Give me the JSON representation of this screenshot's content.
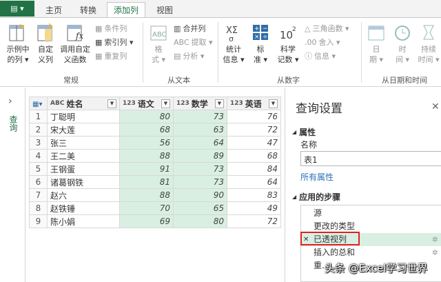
{
  "ribbon": {
    "file_label": "▤ ▾",
    "tabs": [
      "主页",
      "转换",
      "添加列",
      "视图"
    ],
    "groups": {
      "general": {
        "label": "常规",
        "example_col": [
          "示例中",
          "的列 ▾"
        ],
        "custom_col": [
          "自定",
          "义列"
        ],
        "invoke_fn": [
          "调用自定",
          "义函数"
        ],
        "conditional_col": "条件列",
        "index_col": "索引列 ▾",
        "duplicate_col": "重复列"
      },
      "from_text": {
        "label": "从文本",
        "format": [
          "格",
          "式 ▾"
        ],
        "merge_col": "合并列",
        "extract": "提取 ▾",
        "parse": "分析 ▾"
      },
      "from_number": {
        "label": "从数字",
        "statistics": [
          "统计",
          "信息 ▾"
        ],
        "standard": [
          "标",
          "准 ▾"
        ],
        "scientific": [
          "科学",
          "记数 ▾"
        ],
        "trig": "三角函数 ▾",
        "rounding": "舍入 ▾",
        "information": "信息 ▾"
      },
      "from_datetime": {
        "label": "从日期和时间",
        "date": [
          "日",
          "期 ▾"
        ],
        "time": [
          "时",
          "间 ▾"
        ],
        "duration": [
          "持续",
          "时间 ▾"
        ]
      }
    }
  },
  "left_pane": {
    "label": "查询",
    "chevron": "›"
  },
  "grid": {
    "columns": [
      {
        "type": "ABC",
        "name": "姓名"
      },
      {
        "type": "123",
        "name": "语文"
      },
      {
        "type": "123",
        "name": "数学"
      },
      {
        "type": "123",
        "name": "英语"
      }
    ],
    "rows": [
      {
        "i": "1",
        "name": "丁聪明",
        "a": "80",
        "b": "73",
        "c": "76"
      },
      {
        "i": "2",
        "name": "宋大莲",
        "a": "68",
        "b": "63",
        "c": "72"
      },
      {
        "i": "3",
        "name": "张三",
        "a": "56",
        "b": "64",
        "c": "47"
      },
      {
        "i": "4",
        "name": "王二美",
        "a": "88",
        "b": "89",
        "c": "68"
      },
      {
        "i": "5",
        "name": "王钢蛋",
        "a": "91",
        "b": "73",
        "c": "84"
      },
      {
        "i": "6",
        "name": "诸葛钢铁",
        "a": "81",
        "b": "73",
        "c": "64"
      },
      {
        "i": "7",
        "name": "赵六",
        "a": "88",
        "b": "90",
        "c": "83"
      },
      {
        "i": "8",
        "name": "赵铁锤",
        "a": "70",
        "b": "65",
        "c": "49"
      },
      {
        "i": "9",
        "name": "陈小娟",
        "a": "69",
        "b": "80",
        "c": "72"
      }
    ]
  },
  "settings": {
    "title": "查询设置",
    "close": "✕",
    "properties_header": "属性",
    "name_label": "名称",
    "name_value": "表1",
    "all_properties": "所有属性",
    "steps_header": "应用的步骤",
    "steps": [
      "源",
      "更改的类型",
      "已透视列",
      "插入的总和",
      "重..."
    ],
    "selected_step": "已透视列"
  },
  "watermark": "头条 @Excel学习世界",
  "colors": {
    "accent": "#217346",
    "selected": "#d9efe2",
    "highlight_border": "#e02020"
  }
}
